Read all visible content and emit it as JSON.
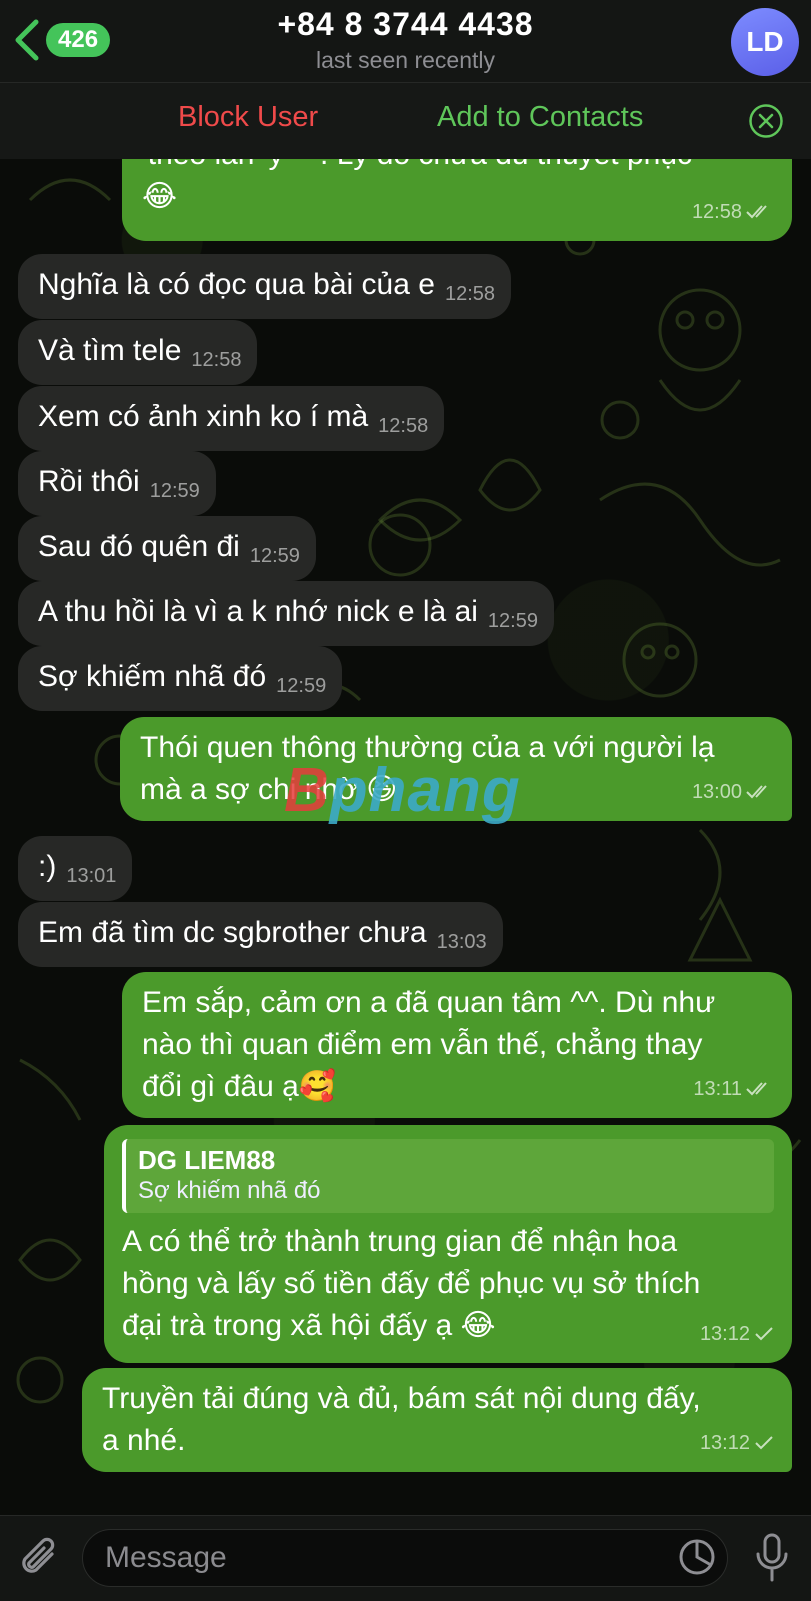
{
  "header": {
    "unread_count": "426",
    "title": "+84 8 3744 4438",
    "subtitle": "last seen recently",
    "avatar_initials": "LD"
  },
  "action_bar": {
    "block_label": "Block User",
    "add_label": "Add to Contacts"
  },
  "messages": [
    {
      "dir": "out",
      "text_lines": [
        "'theo lần' ý ^^. Lý do chưa đủ thuyết phục",
        "😂"
      ],
      "time": "12:58",
      "status": "read"
    },
    {
      "dir": "in",
      "text": "Nghĩa là có đọc qua bài của e",
      "time": "12:58"
    },
    {
      "dir": "in",
      "text": "Và tìm tele",
      "time": "12:58"
    },
    {
      "dir": "in",
      "text": "Xem có ảnh xinh ko í mà",
      "time": "12:58"
    },
    {
      "dir": "in",
      "text": "Rồi thôi",
      "time": "12:59"
    },
    {
      "dir": "in",
      "text": "Sau đó quên đi",
      "time": "12:59"
    },
    {
      "dir": "in",
      "text": "A thu hồi là vì a k nhớ nick e là ai",
      "time": "12:59"
    },
    {
      "dir": "in",
      "text": "Sợ khiếm nhã đó",
      "time": "12:59"
    },
    {
      "dir": "out",
      "text_lines": [
        "Thói quen thông thường của a với người lạ",
        "mà a sợ chi nhờ 😆"
      ],
      "time": "13:00",
      "status": "read"
    },
    {
      "dir": "in",
      "text": ":)",
      "time": "13:01"
    },
    {
      "dir": "in",
      "text": "Em đã tìm dc sgbrother chưa",
      "time": "13:03"
    },
    {
      "dir": "out",
      "text_lines": [
        "Em sắp, cảm ơn a đã quan tâm ^^. Dù như",
        "nào thì quan điểm em vẫn thế, chẳng thay",
        "đổi gì đâu ạ🥰"
      ],
      "time": "13:11",
      "status": "read"
    },
    {
      "dir": "out",
      "reply": {
        "author": "DG LIEM88",
        "text": "Sợ khiếm nhã đó"
      },
      "text_lines": [
        "A có thể trở thành trung gian để nhận hoa",
        "hồng và lấy số tiền đấy để phục vụ sở thích",
        "đại trà trong xã hội đấy ạ 😂"
      ],
      "time": "13:12",
      "status": "sent"
    },
    {
      "dir": "out",
      "text_lines": [
        "Truyền tải đúng và đủ, bám sát nội dung đấy,",
        "a nhé."
      ],
      "time": "13:12",
      "status": "sent"
    }
  ],
  "watermark": {
    "part1": "B",
    "part2": "phang"
  },
  "input": {
    "placeholder": "Message"
  },
  "colors": {
    "outgoing_bubble": "#4b9a2b",
    "incoming_bubble": "#272826",
    "block_red": "#ef4a4a",
    "add_green": "#5fc65a",
    "badge_green": "#44c45a",
    "avatar": "#6a73f5"
  },
  "icons": {
    "back": "chevron-left-icon",
    "close": "close-circle-icon",
    "attach": "paperclip-icon",
    "sticker": "sticker-icon",
    "mic": "microphone-icon"
  }
}
